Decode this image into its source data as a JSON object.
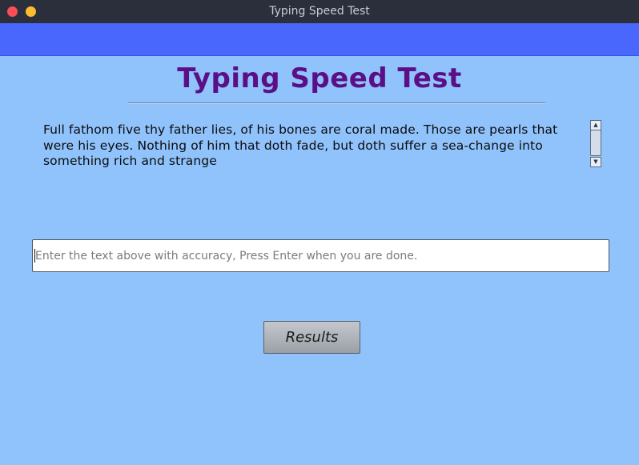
{
  "window": {
    "title": "Typing Speed Test"
  },
  "header": {
    "heading": "Typing Speed Test"
  },
  "passage": {
    "text": "Full fathom five thy father lies, of his bones are coral made. Those are pearls that were his eyes. Nothing of him that doth fade, but doth suffer a sea-change into something rich and strange"
  },
  "entry": {
    "value": "",
    "placeholder": "Enter the text above with accuracy, Press Enter when you are done."
  },
  "actions": {
    "results_label": "Results"
  },
  "colors": {
    "background": "#90c2fc",
    "band": "#4a67fd",
    "heading": "#5b0f86",
    "titlebar": "#2b2e3b"
  },
  "icons": {
    "close": "close-dot-icon",
    "minimize": "minimize-dot-icon",
    "scroll_up": "scroll-up-arrow-icon",
    "scroll_down": "scroll-down-arrow-icon"
  }
}
